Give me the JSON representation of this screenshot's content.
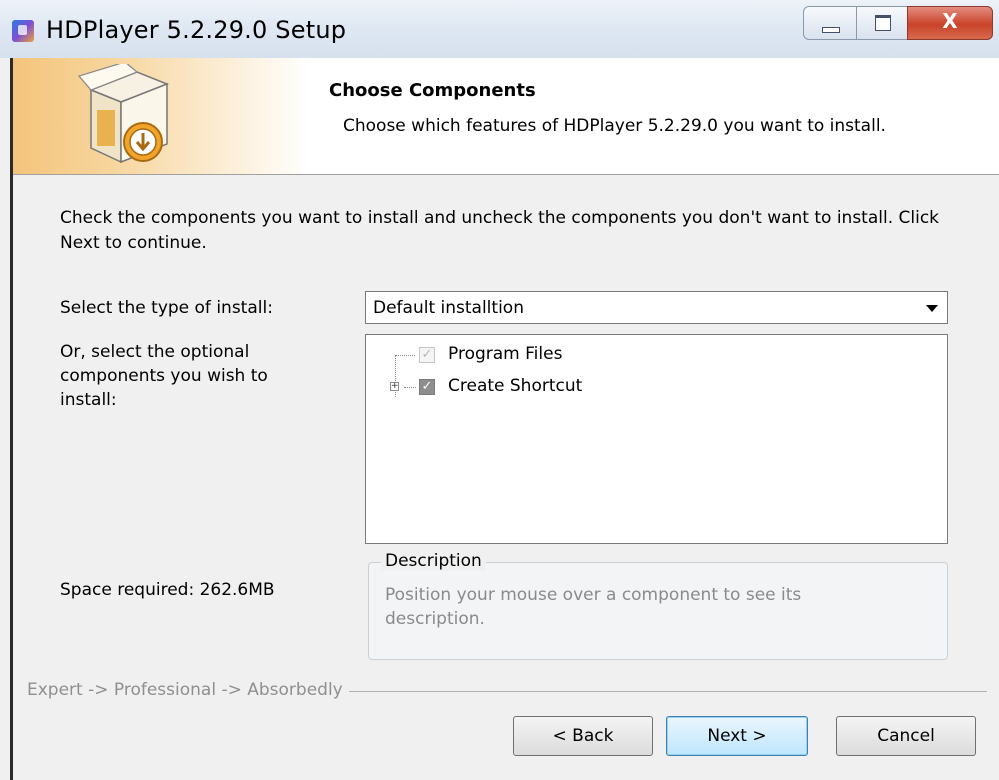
{
  "window": {
    "title": "HDPlayer 5.2.29.0 Setup",
    "close_glyph": "X"
  },
  "header": {
    "title": "Choose Components",
    "subtitle": "Choose which features of HDPlayer 5.2.29.0 you want to install."
  },
  "body": {
    "intro": "Check the components you want to install and uncheck the components you don't want to install. Click Next to continue.",
    "install_type_label": "Select the type of install:",
    "install_type_value": "Default installtion",
    "optional_label": "Or, select the optional components you wish to install:",
    "components": [
      {
        "label": "Program Files",
        "checked": true,
        "disabled": true
      },
      {
        "label": "Create Shortcut",
        "checked": true,
        "expandable": true
      }
    ],
    "space_required": "Space required: 262.6MB",
    "description": {
      "title": "Description",
      "text": "Position your mouse over a component to see its description."
    }
  },
  "footer": {
    "branding": "Expert -> Professional -> Absorbedly",
    "buttons": {
      "back": "< Back",
      "next": "Next >",
      "cancel": "Cancel"
    }
  },
  "icons": {
    "app": "hdplayer-app-icon",
    "header": "install-box-icon",
    "expander": "plus-expander-icon"
  },
  "colors": {
    "header_gradient_start": "#f4c47c",
    "close_button": "#c9432a",
    "next_button_border": "#3c7fb1"
  }
}
